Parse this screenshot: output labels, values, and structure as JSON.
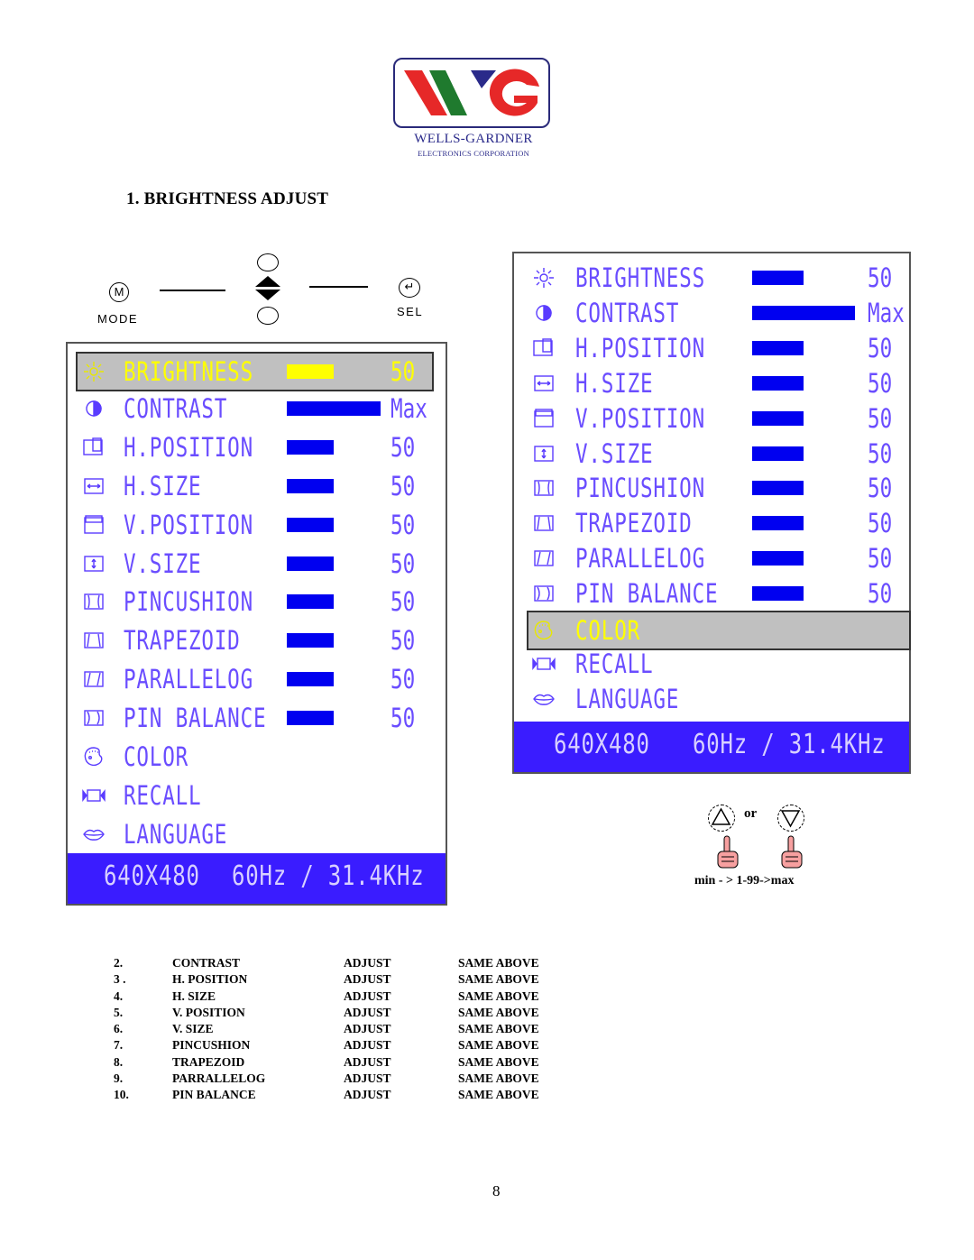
{
  "logo": {
    "initials": "WG",
    "name": "WELLS-GARDNER",
    "subtitle": "ELECTRONICS CORPORATION",
    "colors": {
      "red": "#e62828",
      "green": "#1f7a2e",
      "blue": "#2a2a8a"
    }
  },
  "section_title": "1. BRIGHTNESS ADJUST",
  "controls": {
    "mode_glyph": "M",
    "mode_label": "MODE",
    "sel_glyph": "↵",
    "sel_label": "SEL"
  },
  "osd_left": {
    "selected": "BRIGHTNESS",
    "items": [
      {
        "icon": "sun-icon",
        "label": "BRIGHTNESS",
        "value": "50",
        "level": 0.5
      },
      {
        "icon": "contrast-icon",
        "label": "CONTRAST",
        "value": "Max",
        "level": 1.0
      },
      {
        "icon": "h-position-icon",
        "label": "H.POSITION",
        "value": "50",
        "level": 0.5
      },
      {
        "icon": "h-size-icon",
        "label": "H.SIZE",
        "value": "50",
        "level": 0.5
      },
      {
        "icon": "v-position-icon",
        "label": "V.POSITION",
        "value": "50",
        "level": 0.5
      },
      {
        "icon": "v-size-icon",
        "label": "V.SIZE",
        "value": "50",
        "level": 0.5
      },
      {
        "icon": "pincushion-icon",
        "label": "PINCUSHION",
        "value": "50",
        "level": 0.5
      },
      {
        "icon": "trapezoid-icon",
        "label": "TRAPEZOID",
        "value": "50",
        "level": 0.5
      },
      {
        "icon": "parallelogram-icon",
        "label": "PARALLELOG",
        "value": "50",
        "level": 0.5
      },
      {
        "icon": "pin-balance-icon",
        "label": "PIN BALANCE",
        "value": "50",
        "level": 0.5
      },
      {
        "icon": "palette-icon",
        "label": "COLOR"
      },
      {
        "icon": "recall-icon",
        "label": "RECALL"
      },
      {
        "icon": "lips-icon",
        "label": "LANGUAGE"
      }
    ],
    "footer_resolution": "640X480",
    "footer_freq": "60Hz / 31.4KHz"
  },
  "osd_right": {
    "selected": "COLOR",
    "items": [
      {
        "icon": "sun-icon",
        "label": "BRIGHTNESS",
        "value": "50",
        "level": 0.5
      },
      {
        "icon": "contrast-icon",
        "label": "CONTRAST",
        "value": "Max",
        "level": 1.0
      },
      {
        "icon": "h-position-icon",
        "label": "H.POSITION",
        "value": "50",
        "level": 0.5
      },
      {
        "icon": "h-size-icon",
        "label": "H.SIZE",
        "value": "50",
        "level": 0.5
      },
      {
        "icon": "v-position-icon",
        "label": "V.POSITION",
        "value": "50",
        "level": 0.5
      },
      {
        "icon": "v-size-icon",
        "label": "V.SIZE",
        "value": "50",
        "level": 0.5
      },
      {
        "icon": "pincushion-icon",
        "label": "PINCUSHION",
        "value": "50",
        "level": 0.5
      },
      {
        "icon": "trapezoid-icon",
        "label": "TRAPEZOID",
        "value": "50",
        "level": 0.5
      },
      {
        "icon": "parallelogram-icon",
        "label": "PARALLELOG",
        "value": "50",
        "level": 0.5
      },
      {
        "icon": "pin-balance-icon",
        "label": "PIN BALANCE",
        "value": "50",
        "level": 0.5
      },
      {
        "icon": "palette-icon",
        "label": "COLOR"
      },
      {
        "icon": "recall-icon",
        "label": "RECALL"
      },
      {
        "icon": "lips-icon",
        "label": "LANGUAGE"
      }
    ],
    "footer_resolution": "640X480",
    "footer_freq": "60Hz / 31.4KHz"
  },
  "adjust_hint": {
    "or_text": "or",
    "range_text": "min - > 1-99->max"
  },
  "table": [
    {
      "num": "2.",
      "name": "CONTRAST",
      "action": "ADJUST",
      "note": "SAME ABOVE"
    },
    {
      "num": "3 .",
      "name": "H. POSITION",
      "action": "ADJUST",
      "note": "SAME ABOVE"
    },
    {
      "num": "4.",
      "name": "H. SIZE",
      "action": "ADJUST",
      "note": "SAME ABOVE"
    },
    {
      "num": "5.",
      "name": "V. POSITION",
      "action": "ADJUST",
      "note": "SAME ABOVE"
    },
    {
      "num": "6.",
      "name": "V. SIZE",
      "action": "ADJUST",
      "note": "SAME ABOVE"
    },
    {
      "num": "7.",
      "name": "PINCUSHION",
      "action": "ADJUST",
      "note": "SAME ABOVE"
    },
    {
      "num": "8.",
      "name": "TRAPEZOID",
      "action": "ADJUST",
      "note": "SAME ABOVE"
    },
    {
      "num": "9.",
      "name": "PARRALLELOG",
      "action": "ADJUST",
      "note": "SAME ABOVE"
    },
    {
      "num": "10.",
      "name": "PIN BALANCE",
      "action": "ADJUST",
      "note": "SAME ABOVE"
    }
  ],
  "page_number": "8",
  "osd_colors": {
    "text": "#6a4dff",
    "bar": "#0000f0",
    "highlight_bg": "#c0c0c0",
    "highlight_text": "#ffff00",
    "footer_bg": "#3a1cff"
  }
}
